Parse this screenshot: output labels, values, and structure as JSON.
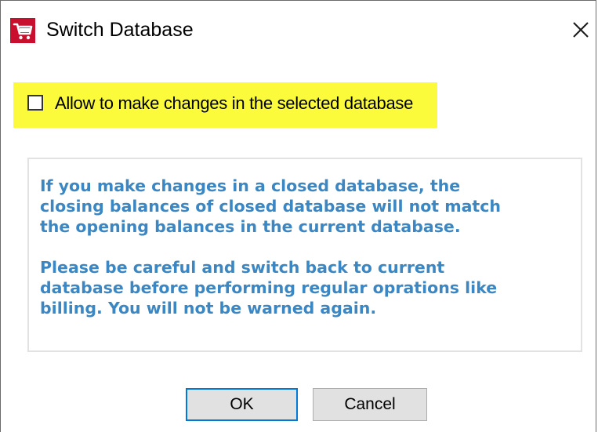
{
  "window": {
    "title": "Switch Database",
    "app_icon": "cart-icon",
    "close_icon": "close-icon"
  },
  "option": {
    "checkbox_label": "Allow to make changes in the selected database",
    "checked": false,
    "highlight_color": "#fbfb3c"
  },
  "warning": {
    "paragraph1": [
      "If you make changes in a closed database, the",
      "closing balances of closed database will not match",
      "the opening balances in the current database."
    ],
    "paragraph2": [
      "Please be careful and switch back to current",
      "database before performing regular oprations like",
      "billing. You will not be warned again."
    ],
    "text_color": "#3b87c4"
  },
  "buttons": {
    "ok_label": "OK",
    "cancel_label": "Cancel"
  }
}
